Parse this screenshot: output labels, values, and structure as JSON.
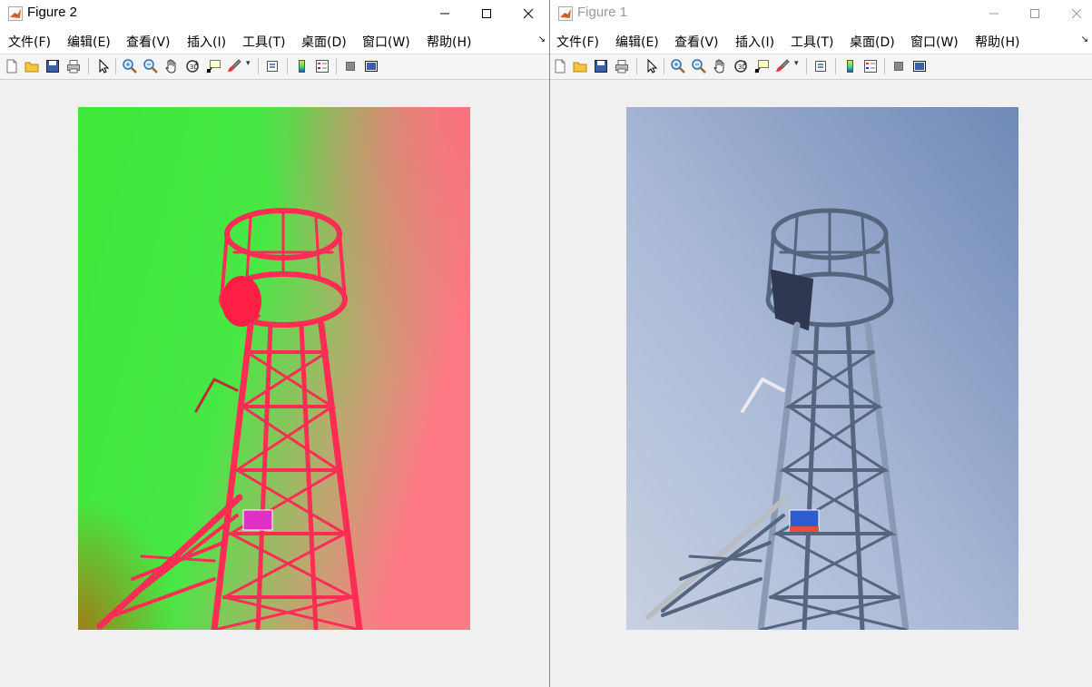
{
  "windows": [
    {
      "title": "Figure 2",
      "menu": [
        "文件(F)",
        "编辑(E)",
        "查看(V)",
        "插入(I)",
        "工具(T)",
        "桌面(D)",
        "窗口(W)",
        "帮助(H)"
      ],
      "image": "tower-photo-false-color"
    },
    {
      "title": "Figure 1",
      "menu": [
        "文件(F)",
        "编辑(E)",
        "查看(V)",
        "插入(I)",
        "工具(T)",
        "桌面(D)",
        "窗口(W)",
        "帮助(H)"
      ],
      "image": "tower-photo-original"
    }
  ],
  "toolbar_tools": [
    "new-figure-icon",
    "open-file-icon",
    "save-icon",
    "print-icon",
    "edit-plot-arrow-icon",
    "zoom-in-icon",
    "zoom-out-icon",
    "pan-hand-icon",
    "rotate-3d-icon",
    "data-cursor-icon",
    "brush-icon",
    "link-plot-icon",
    "insert-colorbar-icon",
    "insert-legend-icon",
    "hide-plot-tools-icon",
    "show-plot-tools-icon"
  ],
  "colors": {
    "left_background_green": "#3ee83a",
    "left_background_pink": "#ff7a86",
    "left_tower": "#ff2d55",
    "right_sky_light": "#bcc7dc",
    "right_sky_dark": "#7890ba",
    "right_tower": "#56657e",
    "sign_left": "#e030c8",
    "sign_right": "#2d5ccf"
  }
}
